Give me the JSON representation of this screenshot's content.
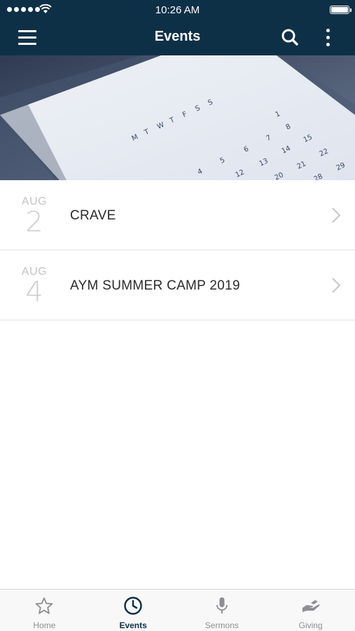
{
  "status_bar": {
    "time": "10:26 AM"
  },
  "header": {
    "title": "Events"
  },
  "events": [
    {
      "month": "AUG",
      "day": "2",
      "title": "CRAVE"
    },
    {
      "month": "AUG",
      "day": "4",
      "title": "AYM SUMMER CAMP 2019"
    }
  ],
  "tabs": [
    {
      "label": "Home",
      "icon": "star-icon",
      "active": false
    },
    {
      "label": "Events",
      "icon": "clock-icon",
      "active": true
    },
    {
      "label": "Sermons",
      "icon": "microphone-icon",
      "active": false
    },
    {
      "label": "Giving",
      "icon": "giving-hand-icon",
      "active": false
    }
  ],
  "colors": {
    "brand": "#0e3047",
    "tab_inactive": "#8e8e93",
    "date_text": "#c4c4c4"
  }
}
